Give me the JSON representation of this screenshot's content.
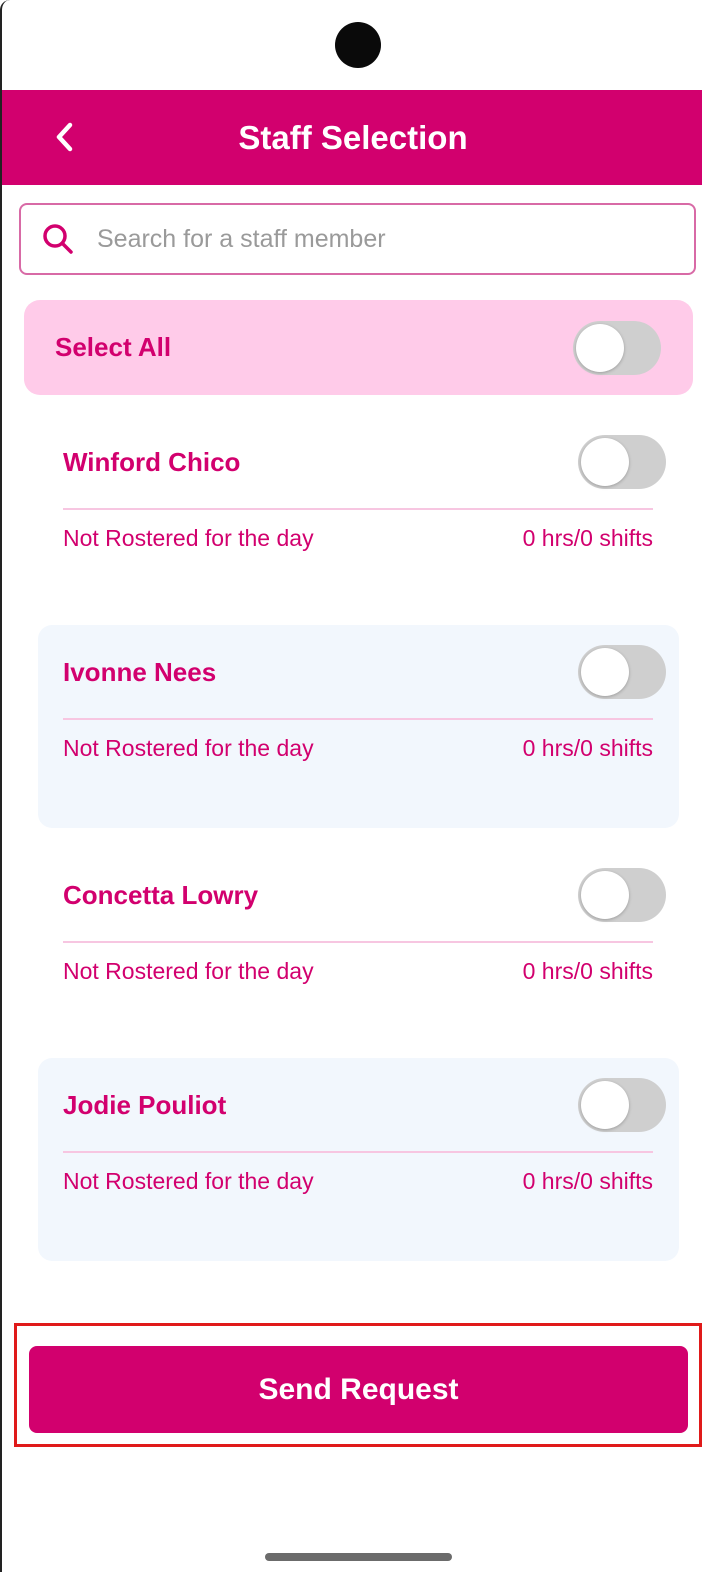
{
  "header": {
    "title": "Staff Selection",
    "back_icon": "chevron-left-icon"
  },
  "search": {
    "placeholder": "Search for a staff member",
    "value": "",
    "icon": "search-icon"
  },
  "select_all": {
    "label": "Select All",
    "on": false
  },
  "staff": [
    {
      "name": "Winford Chico",
      "status": "Not Rostered for the day",
      "hours": "0 hrs/0 shifts",
      "on": false
    },
    {
      "name": "Ivonne Nees",
      "status": "Not Rostered for the day",
      "hours": "0 hrs/0 shifts",
      "on": false
    },
    {
      "name": "Concetta Lowry",
      "status": "Not Rostered for the day",
      "hours": "0 hrs/0 shifts",
      "on": false
    },
    {
      "name": "Jodie Pouliot",
      "status": "Not Rostered for the day",
      "hours": "0 hrs/0 shifts",
      "on": false
    }
  ],
  "footer": {
    "send_label": "Send Request"
  },
  "colors": {
    "primary": "#d2006e",
    "select_all_bg": "#ffcbe9",
    "alt_card_bg": "#f2f7fd",
    "highlight_outline": "#e01a1a"
  }
}
